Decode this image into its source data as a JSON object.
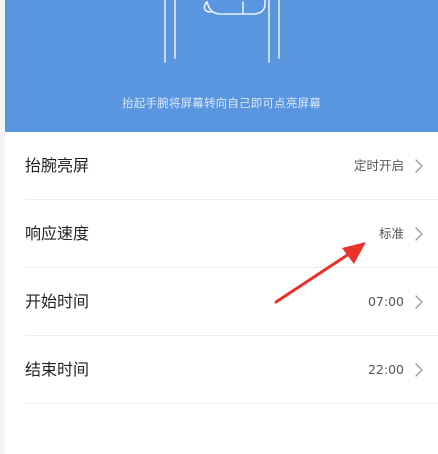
{
  "hero": {
    "caption": "抬起手腕将屏幕转向自己即可点亮屏幕",
    "icon": "wrist-watch-illustration",
    "background": "#5a95e0"
  },
  "settings": [
    {
      "label": "抬腕亮屏",
      "value": "定时开启"
    },
    {
      "label": "响应速度",
      "value": "标准"
    },
    {
      "label": "开始时间",
      "value": "07:00"
    },
    {
      "label": "结束时间",
      "value": "22:00"
    }
  ],
  "annotation": {
    "icon": "red-arrow-icon",
    "color": "#e8332a"
  },
  "colors": {
    "text_primary": "#222222",
    "text_secondary": "#555555",
    "divider": "#ececec"
  }
}
